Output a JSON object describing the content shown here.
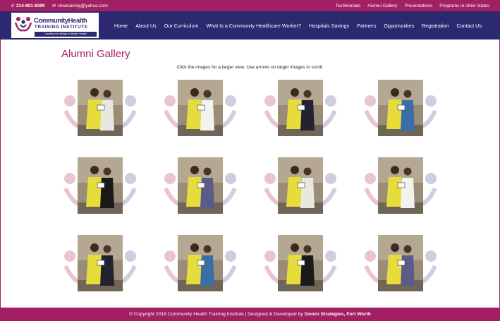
{
  "topbar": {
    "phone": "214-801-8399",
    "email": "chwtraining@yahoo.com",
    "links": [
      "Testimonials",
      "Alumni Gallery",
      "Presentations",
      "Programs in other states"
    ]
  },
  "logo": {
    "line1": "CommunityHealth",
    "line2": "TRAINING INSTITUTE",
    "tagline": "Creating the Bridge to Better Health"
  },
  "nav": {
    "items": [
      "Home",
      "About Us",
      "Our Curriculum",
      "What Is a Community Healthcare Worker?",
      "Hospitals Savings",
      "Partners",
      "Opportunities",
      "Registration",
      "Contact Us"
    ]
  },
  "page": {
    "title": "Alumni Gallery",
    "subtitle": "Click the images for a larger view. Use arrows on larger images to scroll."
  },
  "gallery": {
    "count": 12,
    "columns": 4
  },
  "footer": {
    "prefix": "© Copyright 2016 Community Health Training Institute | Designed & Developed by ",
    "developer": "Gonzo Strategies, Fort Worth"
  },
  "colors": {
    "brand_magenta": "#a31f63",
    "brand_navy": "#2c2970"
  }
}
